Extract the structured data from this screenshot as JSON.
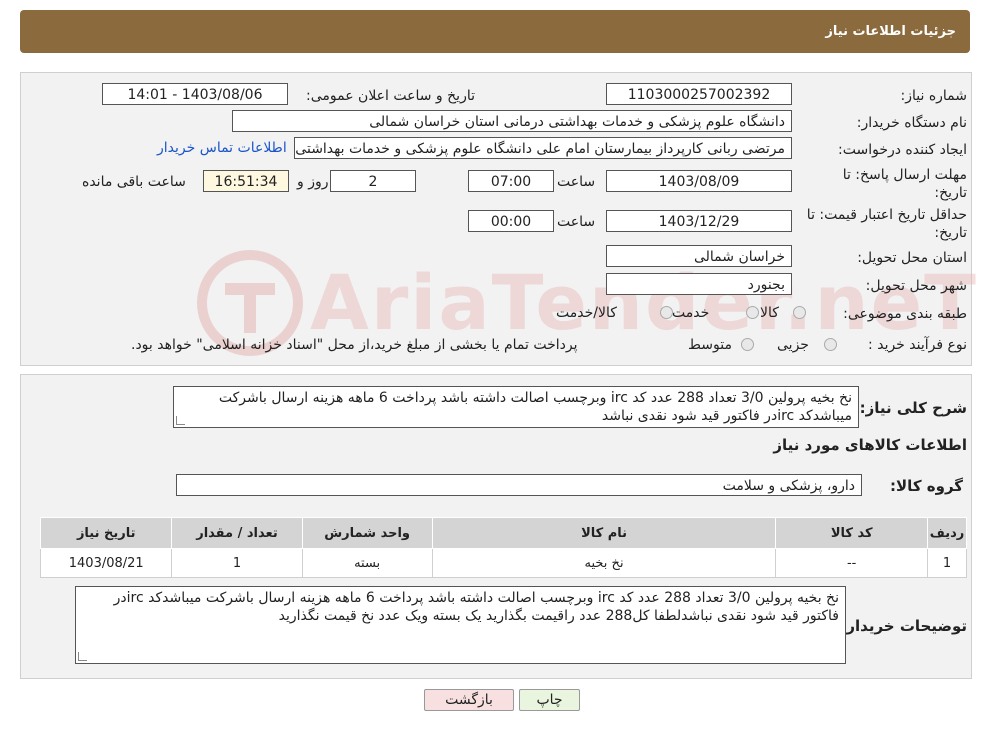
{
  "header": {
    "title": "جزئیات اطلاعات نیاز"
  },
  "watermark": {
    "text": "AriaTender.neT"
  },
  "form": {
    "need_number": {
      "label": "شماره نیاز:",
      "value": "1103000257002392"
    },
    "announce": {
      "label": "تاریخ و ساعت اعلان عمومی:",
      "value": "1403/08/06 - 14:01"
    },
    "buyer_org": {
      "label": "نام دستگاه خریدار:",
      "value": "دانشگاه علوم پزشکی و خدمات بهداشتی درمانی استان خراسان شمالی"
    },
    "creator": {
      "label": "ایجاد کننده درخواست:",
      "value": "مرتضی ربانی کارپرداز بیمارستان امام علی دانشگاه علوم پزشکی و خدمات بهداشتی",
      "link": "اطلاعات تماس خریدار"
    },
    "deadline": {
      "label": "مهلت ارسال پاسخ: تا تاریخ:",
      "date": "1403/08/09",
      "time_label": "ساعت",
      "time": "07:00",
      "days": "2",
      "days_label": "روز و",
      "remaining": "16:51:34",
      "remaining_label": "ساعت باقی مانده"
    },
    "validity": {
      "label": "حداقل تاریخ اعتبار قیمت: تا تاریخ:",
      "date": "1403/12/29",
      "time_label": "ساعت",
      "time": "00:00"
    },
    "province": {
      "label": "استان محل تحویل:",
      "value": "خراسان شمالی"
    },
    "city": {
      "label": "شهر محل تحویل:",
      "value": "بجنورد"
    },
    "category": {
      "label": "طبقه بندی موضوعی:",
      "options": [
        "کالا",
        "خدمت",
        "کالا/خدمت"
      ]
    },
    "process": {
      "label": "نوع فرآیند خرید :",
      "options": [
        "جزیی",
        "متوسط"
      ],
      "note": "پرداخت تمام یا بخشی از مبلغ خرید،از محل \"اسناد خزانه اسلامی\" خواهد بود."
    }
  },
  "description": {
    "label": "شرح کلی نیاز:",
    "text": "نخ بخیه پرولین 3/0 تعداد 288 عدد کد irc وبرچسب اصالت داشته باشد پرداخت 6 ماهه هزینه ارسال باشرکت میباشدکد ircدر فاکتور قید شود نقدی نباشد"
  },
  "goods": {
    "section_title": "اطلاعات کالاهای مورد نیاز",
    "group_label": "گروه کالا:",
    "group_value": "دارو، پزشکی و سلامت",
    "columns": [
      "ردیف",
      "کد کالا",
      "نام کالا",
      "واحد شمارش",
      "تعداد / مقدار",
      "تاریخ نیاز"
    ],
    "rows": [
      [
        "1",
        "--",
        "نخ بخیه",
        "بسته",
        "1",
        "1403/08/21"
      ]
    ]
  },
  "buyer_notes": {
    "label": "توضیحات خریدار:",
    "text": "نخ بخیه پرولین 3/0 تعداد 288 عدد کد irc وبرچسب اصالت داشته باشد پرداخت 6 ماهه هزینه ارسال باشرکت میباشدکد ircدر فاکتور قید شود نقدی نباشدلطفا کل288 عدد راقیمت بگذارید یک بسته ویک عدد نخ قیمت نگذارید"
  },
  "buttons": {
    "print": "چاپ",
    "back": "بازگشت"
  }
}
